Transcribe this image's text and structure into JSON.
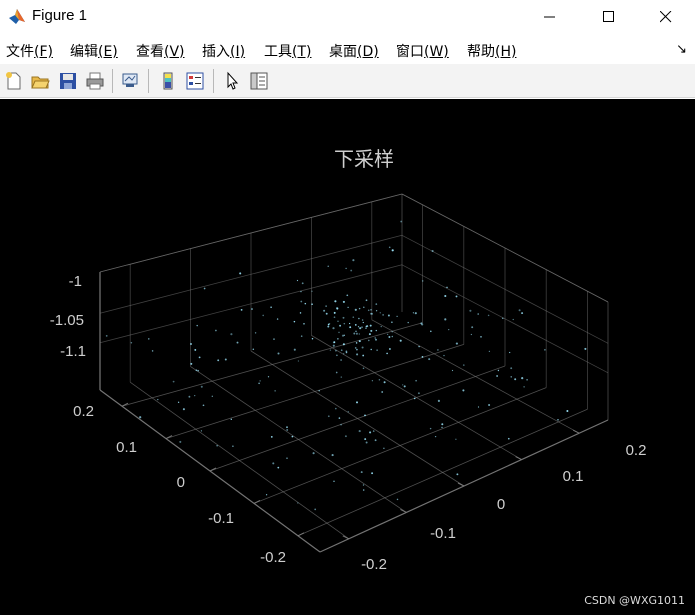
{
  "window": {
    "title": "Figure 1",
    "icon": "matlab-icon",
    "controls": [
      "minimize-icon",
      "maximize-icon",
      "close-icon"
    ]
  },
  "menu": {
    "items": [
      {
        "label": "文件",
        "key": "(F)"
      },
      {
        "label": "编辑",
        "key": "(E)"
      },
      {
        "label": "查看",
        "key": "(V)"
      },
      {
        "label": "插入",
        "key": "(I)"
      },
      {
        "label": "工具",
        "key": "(T)"
      },
      {
        "label": "桌面",
        "key": "(D)"
      },
      {
        "label": "窗口",
        "key": "(W)"
      },
      {
        "label": "帮助",
        "key": "(H)"
      }
    ],
    "dock_arrow": "↘"
  },
  "toolbar": {
    "buttons": [
      "new-figure-icon",
      "open-file-icon",
      "save-icon",
      "print-icon",
      "link-plot-icon",
      "colorbar-icon",
      "legend-icon",
      "pointer-icon",
      "property-inspector-icon"
    ]
  },
  "colors": {
    "figure_background": "#000000",
    "axes_color": "#808080",
    "text_color": "#cfcfcf",
    "point_color": "#9fe9ff"
  },
  "chart_data": {
    "type": "scatter",
    "dimension": "3d",
    "title": "下采样",
    "xlabel": "",
    "ylabel": "",
    "zlabel": "",
    "xlim": [
      -0.25,
      0.25
    ],
    "ylim": [
      -0.25,
      0.25
    ],
    "zlim": [
      -1.12,
      -1.0
    ],
    "grid": true,
    "x_ticks": [
      "-0.2",
      "-0.1",
      "0",
      "0.1",
      "0.2"
    ],
    "y_ticks": [
      "-0.2",
      "-0.1",
      "0",
      "0.1",
      "0.2"
    ],
    "z_ticks": [
      "-1",
      "-1.05",
      "-1.1"
    ],
    "point_count_note": "sparse downsampled point cloud, denser near center"
  },
  "watermark": "CSDN @WXG1011"
}
